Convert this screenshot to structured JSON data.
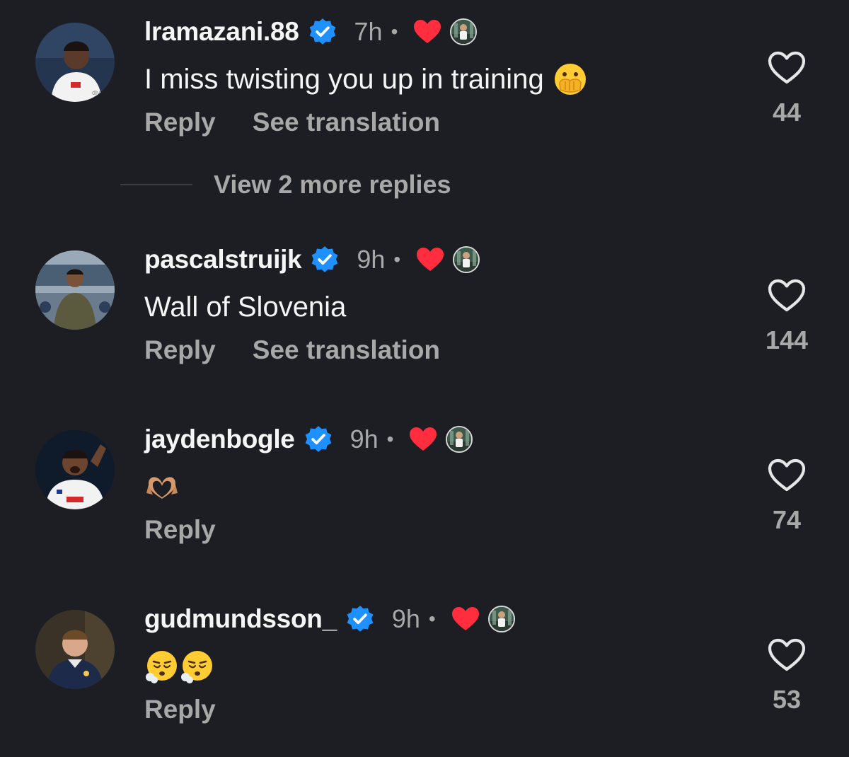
{
  "colors": {
    "background": "#1d1e23",
    "text_primary": "#f5f5f5",
    "text_secondary": "#a8a8a8",
    "verified_blue": "#1e90ff",
    "heart_red": "#ff2d3d"
  },
  "comments": [
    {
      "username": "lramazani.88",
      "time": "7h",
      "separator": "•",
      "verified_icon": "verified-badge-icon",
      "creator_liked_icon": "red-heart-icon",
      "text": "I miss twisting you up in training",
      "emoji": [
        "face-with-open-eyes-and-hand-over-mouth"
      ],
      "reply_label": "Reply",
      "translate_label": "See translation",
      "like_count": "44"
    },
    {
      "username": "pascalstruijk",
      "time": "9h",
      "separator": "•",
      "verified_icon": "verified-badge-icon",
      "creator_liked_icon": "red-heart-icon",
      "text": "Wall of Slovenia",
      "emoji": [],
      "reply_label": "Reply",
      "translate_label": "See translation",
      "like_count": "144"
    },
    {
      "username": "jaydenbogle",
      "time": "9h",
      "separator": "•",
      "verified_icon": "verified-badge-icon",
      "creator_liked_icon": "red-heart-icon",
      "text": "",
      "emoji": [
        "heart-hands"
      ],
      "reply_label": "Reply",
      "like_count": "74"
    },
    {
      "username": "gudmundsson_",
      "time": "9h",
      "separator": "•",
      "verified_icon": "verified-badge-icon",
      "creator_liked_icon": "red-heart-icon",
      "text": "",
      "emoji": [
        "face-exhaling",
        "face-exhaling"
      ],
      "reply_label": "Reply",
      "like_count": "53"
    }
  ],
  "view_more_replies": "View 2 more replies"
}
